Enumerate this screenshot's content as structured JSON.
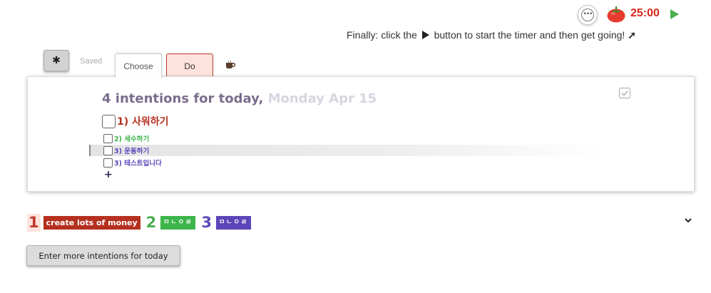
{
  "timer": {
    "more_icon": "ellipsis-circle-icon",
    "tomato_icon": "tomato-icon",
    "time": "25:00",
    "play_icon": "play-icon",
    "hint_before": "Finally: click the",
    "hint_after": "button to start the timer and then get going!",
    "hint_arrow": "➚"
  },
  "tabs": {
    "gear_icon": "gear-icon",
    "saved_label": "Saved",
    "choose_label": "Choose",
    "do_label": "Do",
    "coffee_icon": "coffee-cup-icon"
  },
  "panel": {
    "title_prefix": "4 intentions for today,",
    "title_date": "Monday Apr 15",
    "main_intention": "1) 사워하기",
    "sub_intentions": [
      {
        "label": "2) 세수하기",
        "color": "#3cb54a"
      },
      {
        "label": "3) 운동하기",
        "color": "#5b45b8"
      },
      {
        "label": "3) 테스트입니다",
        "color": "#5b45b8"
      }
    ],
    "add_label": "+"
  },
  "strip": {
    "items": [
      {
        "number": "1",
        "label": "create lots of money",
        "color": "#b5301f"
      },
      {
        "number": "2",
        "label": "ㅁㄴㅇㄹ",
        "color": "#3cb54a"
      },
      {
        "number": "3",
        "label": "ㅁㄴㅇㄹ",
        "color": "#5b45b8"
      }
    ]
  },
  "more_button_label": "Enter more intentions for today",
  "colors": {
    "accent_red": "#d9261c",
    "play_green": "#4caf50",
    "title_purple": "#7a6d8c"
  }
}
